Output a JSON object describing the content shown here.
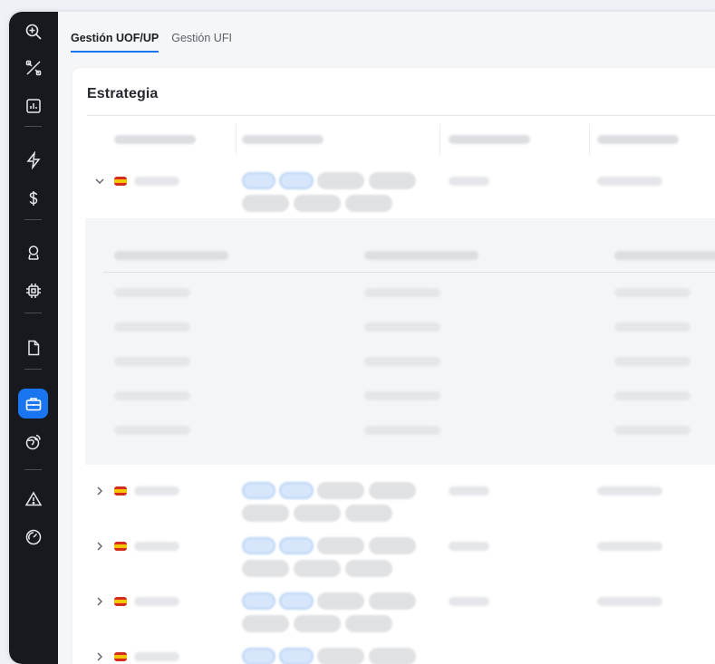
{
  "tabs": [
    {
      "label": "Gestión UOF/UP",
      "active": true
    },
    {
      "label": "Gestión UFI",
      "active": false
    }
  ],
  "card": {
    "title": "Estrategia"
  },
  "sidebar": {
    "icons": [
      "zoom-in-icon",
      "tools-icon",
      "chart-icon",
      "bolt-icon",
      "dollar-icon",
      "certificate-icon",
      "chip-icon",
      "document-icon",
      "briefcase-icon",
      "globe-icon",
      "warning-icon",
      "gauge-icon"
    ],
    "active": "briefcase-icon"
  },
  "colors": {
    "accent": "#1976f0",
    "sidebar": "#17191e",
    "flag_red": "#d52b1e",
    "flag_yellow": "#f6c400"
  }
}
